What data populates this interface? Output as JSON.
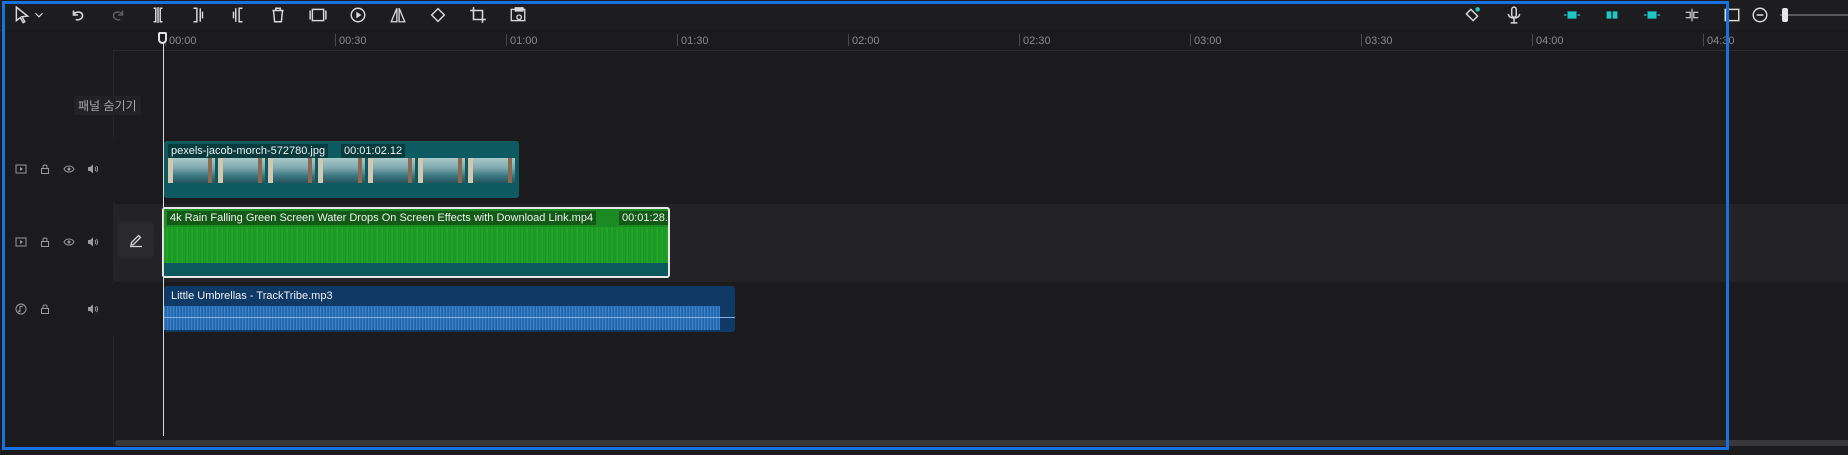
{
  "toolbar": {
    "left_icons": [
      "select-pointer-icon",
      "chevron-down-icon",
      "undo-icon",
      "redo-icon",
      "split-icon",
      "split-left-icon",
      "split-right-icon",
      "delete-icon",
      "freeze-frame-icon",
      "speed-icon",
      "mirror-icon",
      "rotate-icon",
      "crop-icon",
      "auto-reframe-icon"
    ],
    "right_icons": [
      "magic-marker-icon",
      "microphone-icon",
      "main-track-magnet-icon",
      "auto-snap-icon",
      "linkage-icon",
      "preview-axis-icon",
      "screenshot-icon",
      "zoom-out-icon"
    ],
    "accent_color": "#1fc7c7"
  },
  "ruler": {
    "labels": [
      "00:00",
      "00:30",
      "01:00",
      "01:30",
      "02:00",
      "02:30",
      "03:00",
      "03:30",
      "04:00",
      "04:30"
    ]
  },
  "left_panel": {
    "hide_panel_label": "패널 숨기기"
  },
  "tracks": {
    "photo": {
      "clip_name": "pexels-jacob-morch-572780.jpg",
      "duration": "00:01:02.12"
    },
    "video": {
      "clip_name": "4k Rain Falling Green Screen Water Drops On Screen Effects with Download Link.mp4",
      "duration": "00:01:28."
    },
    "audio": {
      "clip_name": "Little Umbrellas - TrackTribe.mp3"
    }
  },
  "colors": {
    "selection": "#1772e0",
    "photo_clip": "#0d5b60",
    "video_clip": "#1c8a22",
    "audio_clip": "#0f3a66"
  }
}
